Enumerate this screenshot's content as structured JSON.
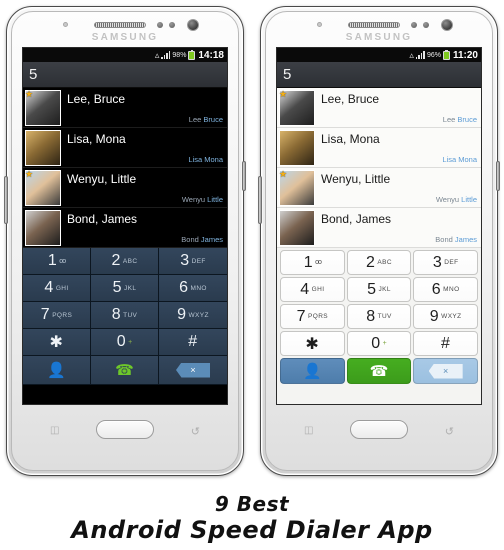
{
  "caption": {
    "line1": "9 Best",
    "line2": "Android Speed Dialer App"
  },
  "phones": [
    {
      "id": "phone-dark",
      "brand": "SAMSUNG",
      "theme": "dark",
      "status_bar": {
        "wifi_icon": "wifi-icon",
        "signal_icon": "signal-icon",
        "battery_percent": "98%",
        "battery_icon": "battery-icon",
        "time": "14:18"
      },
      "dial_input": {
        "value": "5",
        "placeholder": ""
      },
      "contacts": [
        {
          "name": "Lee, Bruce",
          "sub_plain": "Lee ",
          "sub_hl": "Bruce",
          "favorite": true,
          "avatar": "bruce-lee-avatar"
        },
        {
          "name": "Lisa, Mona",
          "sub_plain": "",
          "sub_hl": "Lisa Mona",
          "favorite": false,
          "avatar": "mona-lisa-avatar"
        },
        {
          "name": "Wenyu, Little",
          "sub_plain": "Wenyu ",
          "sub_hl": "Little",
          "favorite": true,
          "avatar": "little-wenyu-avatar"
        },
        {
          "name": "Bond, James",
          "sub_plain": "Bond ",
          "sub_hl": "James",
          "favorite": false,
          "avatar": "james-bond-avatar"
        }
      ],
      "keypad": [
        {
          "digit": "1",
          "letters": "",
          "vm": "oo"
        },
        {
          "digit": "2",
          "letters": "ABC",
          "vm": ""
        },
        {
          "digit": "3",
          "letters": "DEF",
          "vm": ""
        },
        {
          "digit": "4",
          "letters": "GHI",
          "vm": ""
        },
        {
          "digit": "5",
          "letters": "JKL",
          "vm": ""
        },
        {
          "digit": "6",
          "letters": "MNO",
          "vm": ""
        },
        {
          "digit": "7",
          "letters": "PQRS",
          "vm": ""
        },
        {
          "digit": "8",
          "letters": "TUV",
          "vm": ""
        },
        {
          "digit": "9",
          "letters": "WXYZ",
          "vm": ""
        },
        {
          "digit": "✱",
          "letters": "",
          "vm": ""
        },
        {
          "digit": "0",
          "letters": "",
          "plus": "+"
        },
        {
          "digit": "#",
          "letters": "",
          "vm": ""
        }
      ],
      "actions": {
        "contacts_icon": "person-icon",
        "call_icon": "phone-call-icon",
        "delete_icon": "backspace-icon",
        "delete_glyph": "×"
      },
      "hardware": {
        "home_button": "home-button",
        "menu_icon": "menu-icon",
        "back_icon": "back-icon",
        "camera": "front-camera",
        "earpiece": "earpiece-speaker"
      }
    },
    {
      "id": "phone-light",
      "brand": "SAMSUNG",
      "theme": "light",
      "status_bar": {
        "wifi_icon": "wifi-icon",
        "signal_icon": "signal-icon",
        "battery_percent": "96%",
        "battery_icon": "battery-icon",
        "time": "11:20"
      },
      "dial_input": {
        "value": "5",
        "placeholder": ""
      },
      "contacts": [
        {
          "name": "Lee, Bruce",
          "sub_plain": "Lee ",
          "sub_hl": "Bruce",
          "favorite": true,
          "avatar": "bruce-lee-avatar"
        },
        {
          "name": "Lisa, Mona",
          "sub_plain": "",
          "sub_hl": "Lisa Mona",
          "favorite": false,
          "avatar": "mona-lisa-avatar"
        },
        {
          "name": "Wenyu, Little",
          "sub_plain": "Wenyu ",
          "sub_hl": "Little",
          "favorite": true,
          "avatar": "little-wenyu-avatar"
        },
        {
          "name": "Bond, James",
          "sub_plain": "Bond ",
          "sub_hl": "James",
          "favorite": false,
          "avatar": "james-bond-avatar"
        }
      ],
      "keypad": [
        {
          "digit": "1",
          "letters": "",
          "vm": "oo"
        },
        {
          "digit": "2",
          "letters": "ABC",
          "vm": ""
        },
        {
          "digit": "3",
          "letters": "DEF",
          "vm": ""
        },
        {
          "digit": "4",
          "letters": "GHI",
          "vm": ""
        },
        {
          "digit": "5",
          "letters": "JKL",
          "vm": ""
        },
        {
          "digit": "6",
          "letters": "MNO",
          "vm": ""
        },
        {
          "digit": "7",
          "letters": "PQRS",
          "vm": ""
        },
        {
          "digit": "8",
          "letters": "TUV",
          "vm": ""
        },
        {
          "digit": "9",
          "letters": "WXYZ",
          "vm": ""
        },
        {
          "digit": "✱",
          "letters": "",
          "vm": ""
        },
        {
          "digit": "0",
          "letters": "",
          "plus": "+"
        },
        {
          "digit": "#",
          "letters": "",
          "vm": ""
        }
      ],
      "actions": {
        "contacts_icon": "person-icon",
        "call_icon": "phone-call-icon",
        "delete_icon": "backspace-icon",
        "delete_glyph": "×"
      },
      "hardware": {
        "home_button": "home-button",
        "menu_icon": "menu-icon",
        "back_icon": "back-icon",
        "camera": "front-camera",
        "earpiece": "earpiece-speaker"
      }
    }
  ],
  "colors": {
    "dark_key": "#2f4256",
    "light_key": "#ffffff",
    "call_green": "#46ad20",
    "contacts_blue": "#5f8dbb",
    "delete_blue": "#a8c9e6",
    "highlight_text": "#5b9bd5",
    "battery_green": "#7ec820"
  }
}
